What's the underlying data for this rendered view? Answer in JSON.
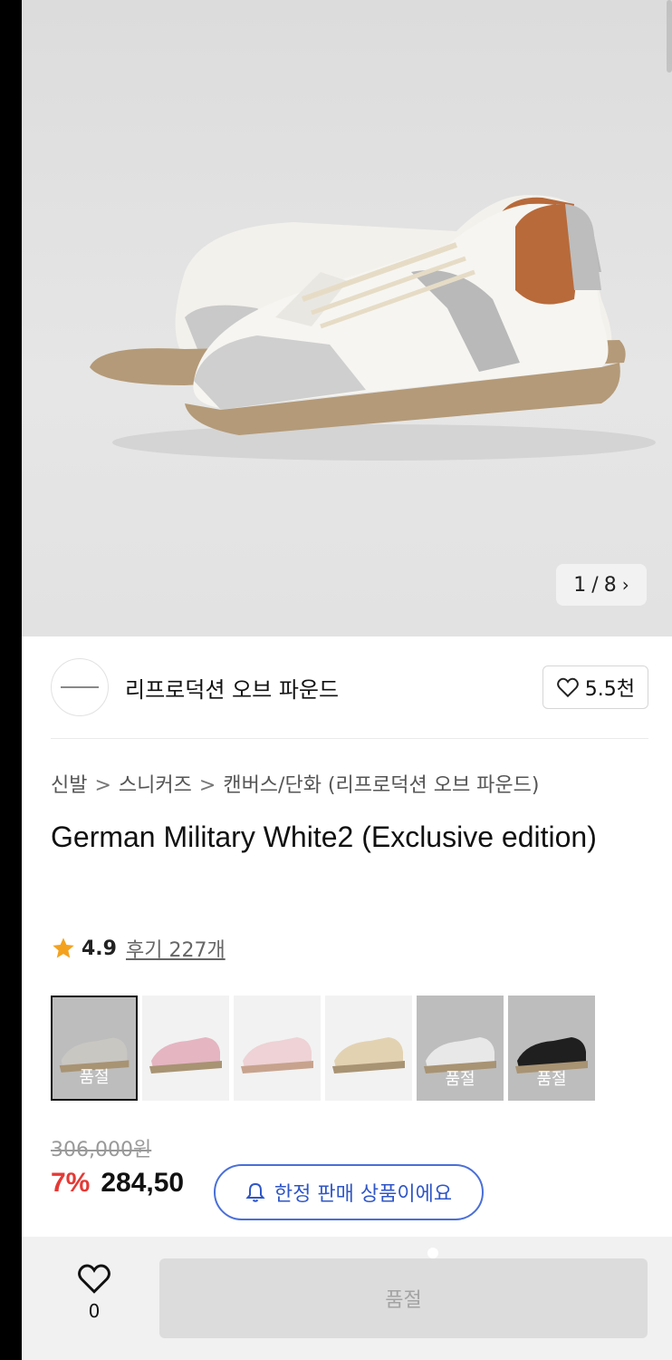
{
  "gallery": {
    "current": "1",
    "total": "8",
    "separator": "/"
  },
  "brand": {
    "name": "리프로덕션 오브 파운드",
    "likes": "5.5천"
  },
  "breadcrumb": [
    "신발",
    "스니커즈",
    "캔버스/단화 (리프로덕션 오브 파운드)"
  ],
  "product": {
    "title": "German Military White2 (Exclusive edition)",
    "rating": "4.9",
    "reviews": "후기 227개"
  },
  "options": [
    {
      "status": "품절",
      "color": "#c9c7c2"
    },
    {
      "status": "",
      "color": "#e5b5c2"
    },
    {
      "status": "",
      "color": "#eed2d5"
    },
    {
      "status": "",
      "color": "#e3d2b2"
    },
    {
      "status": "품절",
      "color": "#e8e8e8"
    },
    {
      "status": "품절",
      "color": "#1f1f1f"
    }
  ],
  "price": {
    "original": "306,000원",
    "discount": "7%",
    "sale": "284,50"
  },
  "notice": {
    "limited": "한정 판매 상품이에요"
  },
  "footer": {
    "wish_count": "0",
    "buy_label": "품절"
  },
  "colors": {
    "accent_blue": "#2f56c7",
    "discount_red": "#e53935",
    "star": "#f4a21e"
  }
}
